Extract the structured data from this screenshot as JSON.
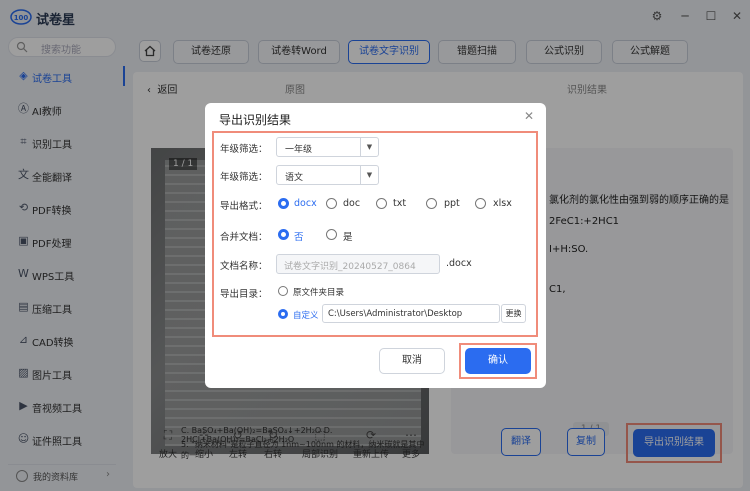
{
  "app": {
    "name": "试卷星",
    "logo_text": "100"
  },
  "window_controls": [
    "⚙",
    "─",
    "☐",
    "✕"
  ],
  "sidebar": {
    "search_placeholder": "搜索功能",
    "items": [
      {
        "label": "试卷工具",
        "icon": "layers-icon",
        "glyph": "◈",
        "active": true
      },
      {
        "label": "AI教师",
        "icon": "ai-icon",
        "glyph": "Ⓐ"
      },
      {
        "label": "识别工具",
        "icon": "scan-icon",
        "glyph": "⌗"
      },
      {
        "label": "全能翻译",
        "icon": "translate-icon",
        "glyph": "文"
      },
      {
        "label": "PDF转换",
        "icon": "pdf-convert-icon",
        "glyph": "⟲"
      },
      {
        "label": "PDF处理",
        "icon": "pdf-process-icon",
        "glyph": "▣"
      },
      {
        "label": "WPS工具",
        "icon": "wps-icon",
        "glyph": "W"
      },
      {
        "label": "压缩工具",
        "icon": "compress-icon",
        "glyph": "▤"
      },
      {
        "label": "CAD转换",
        "icon": "cad-icon",
        "glyph": "⊿"
      },
      {
        "label": "图片工具",
        "icon": "image-icon",
        "glyph": "▨"
      },
      {
        "label": "音视频工具",
        "icon": "media-icon",
        "glyph": "▶"
      },
      {
        "label": "证件照工具",
        "icon": "id-photo-icon",
        "glyph": "☺"
      }
    ],
    "library": "我的资料库"
  },
  "tabs": [
    {
      "label": "试卷还原"
    },
    {
      "label": "试卷转Word"
    },
    {
      "label": "试卷文字识别",
      "active": true
    },
    {
      "label": "错题扫描"
    },
    {
      "label": "公式识别"
    },
    {
      "label": "公式解题"
    }
  ],
  "panel": {
    "back": "返回",
    "original_header": "原图",
    "result_header": "识别结果",
    "page_indicator": "1 / 1",
    "result_page": "1 / 1",
    "doc_lines": [
      "C. BaSO₄+Ba(OH)₂=BaSO₄↓+2H₂O      D. 2HCl+Ba(OH)₂=BaCl₂+2H₂O",
      "5. \"纳米材料\"是粒子直径为 1nm~100nm 的材料，纳米碳就是其中的一"
    ],
    "result_lines": [
      "氯化剂的氯化性由强到弱的顺序正确的是",
      "2FeC1:+2HC1",
      "I+H:SO.",
      "C1,"
    ]
  },
  "toolbar": [
    {
      "label": "放大",
      "icon": "zoom-in-icon",
      "glyph": "⛶"
    },
    {
      "label": "缩小",
      "icon": "zoom-out-icon",
      "glyph": "⊹"
    },
    {
      "label": "左转",
      "icon": "rotate-left-icon",
      "glyph": "↺"
    },
    {
      "label": "右转",
      "icon": "rotate-right-icon",
      "glyph": "↻"
    },
    {
      "label": "局部识别",
      "icon": "partial-recognize-icon",
      "glyph": "⬚"
    },
    {
      "label": "重新上传",
      "icon": "reupload-icon",
      "glyph": "⟳"
    },
    {
      "label": "更多",
      "icon": "more-icon",
      "glyph": "⋯"
    }
  ],
  "actions": {
    "translate": "翻译",
    "copy": "复制",
    "export": "导出识别结果"
  },
  "dialog": {
    "title": "导出识别结果",
    "grade_label": "年级筛选：",
    "grade_value": "一年级",
    "subject_label": "年级筛选：",
    "subject_value": "语文",
    "format_label": "导出格式：",
    "formats": [
      {
        "label": "docx",
        "selected": true
      },
      {
        "label": "doc"
      },
      {
        "label": "txt"
      },
      {
        "label": "ppt"
      },
      {
        "label": "xlsx"
      }
    ],
    "merge_label": "合并文档：",
    "merge_options": [
      {
        "label": "否",
        "selected": true
      },
      {
        "label": "是"
      }
    ],
    "filename_label": "文档名称：",
    "filename_value": "试卷文字识别_20240527_0864",
    "filename_ext": ".docx",
    "dir_label": "导出目录：",
    "dir_option_source": "原文件夹目录",
    "dir_option_custom": "自定义",
    "dir_path": "C:\\Users\\Administrator\\Desktop",
    "change_button": "更换",
    "cancel_button": "取消",
    "confirm_button": "确认"
  },
  "colors": {
    "accent": "#2b6cf0",
    "highlight": "#f08c7a"
  }
}
